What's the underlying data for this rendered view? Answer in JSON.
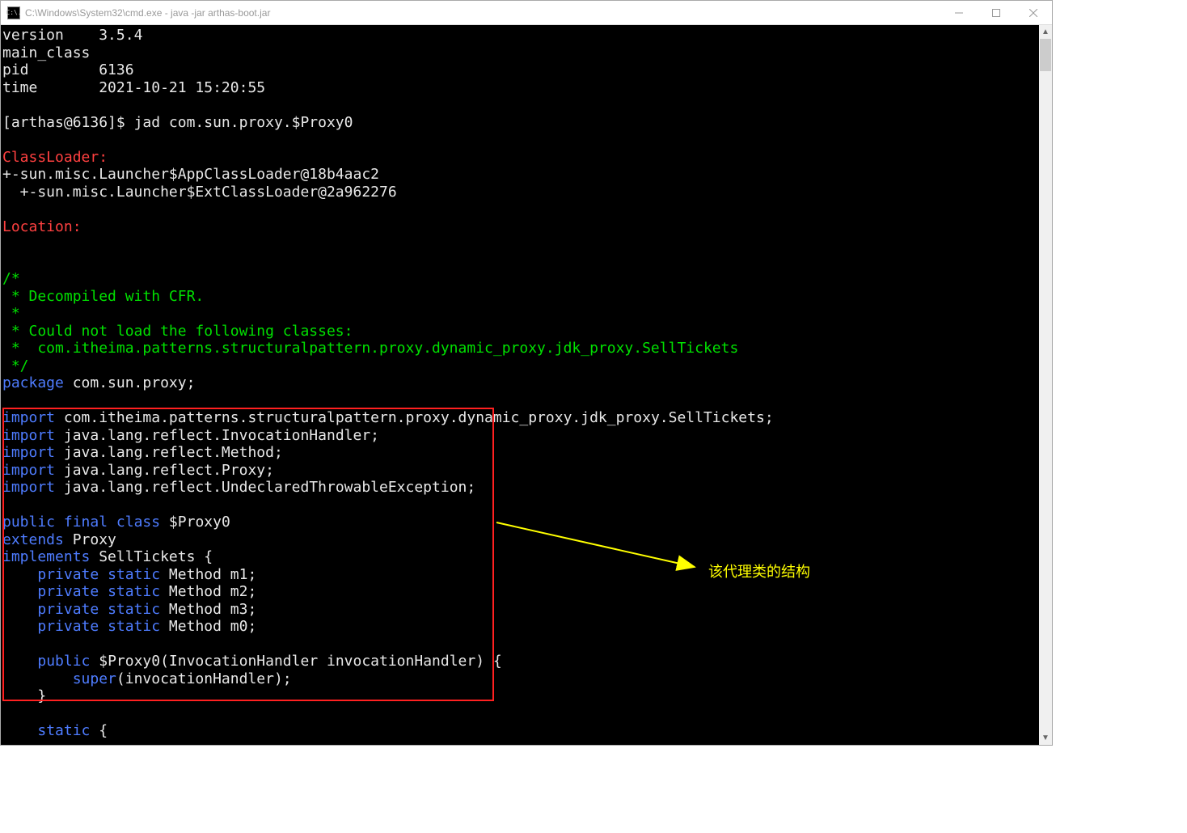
{
  "window": {
    "icon_text": "C:\\.",
    "title": "C:\\Windows\\System32\\cmd.exe - java  -jar arthas-boot.jar"
  },
  "info": {
    "version_label": "version",
    "version_value": "3.5.4",
    "main_class_label": "main_class",
    "pid_label": "pid",
    "pid_value": "6136",
    "time_label": "time",
    "time_value": "2021-10-21 15:20:55"
  },
  "prompt": {
    "text": "[arthas@6136]$ ",
    "command": "jad com.sun.proxy.$Proxy0"
  },
  "sections": {
    "classloader_label": "ClassLoader:",
    "classloader_lines": [
      "+-sun.misc.Launcher$AppClassLoader@18b4aac2",
      "  +-sun.misc.Launcher$ExtClassLoader@2a962276"
    ],
    "location_label": "Location:"
  },
  "comment": {
    "l1": "/*",
    "l2": " * Decompiled with CFR.",
    "l3": " * ",
    "l4": " * Could not load the following classes:",
    "l5": " *  com.itheima.patterns.structuralpattern.proxy.dynamic_proxy.jdk_proxy.SellTickets",
    "l6": " */"
  },
  "code": {
    "package_kw": "package",
    "package_name": " com.sun.proxy;",
    "import_kw": "import",
    "imports": [
      " com.itheima.patterns.structuralpattern.proxy.dynamic_proxy.jdk_proxy.SellTickets;",
      " java.lang.reflect.InvocationHandler;",
      " java.lang.reflect.Method;",
      " java.lang.reflect.Proxy;",
      " java.lang.reflect.UndeclaredThrowableException;"
    ],
    "public_kw": "public",
    "final_kw": "final",
    "class_kw": "class",
    "class_name": " $Proxy0",
    "extends_kw": "extends",
    "extends_name": " Proxy",
    "implements_kw": "implements",
    "implements_name": " SellTickets {",
    "private_kw": "private",
    "static_kw": "static",
    "fields": [
      " Method m1;",
      " Method m2;",
      " Method m3;",
      " Method m0;"
    ],
    "ctor_sig": " $Proxy0(InvocationHandler invocationHandler)",
    "brace": " {",
    "super_kw": "super",
    "super_args": "(invocationHandler);",
    "close_brace": "    }",
    "static_block": " {",
    "indent4": "    ",
    "indent8": "        "
  },
  "annotation": {
    "label": "该代理类的结构"
  }
}
